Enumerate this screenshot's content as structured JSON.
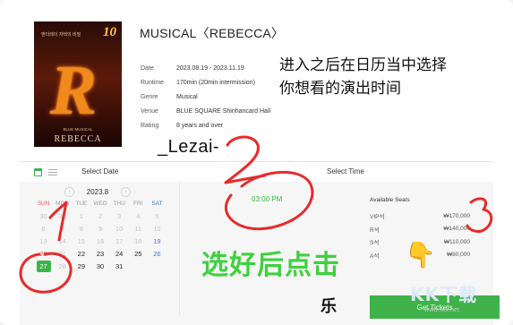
{
  "show": {
    "title": "MUSICAL〈REBECCA〉",
    "details": [
      {
        "key": "Date",
        "value": "2023.08.19 - 2023.11.19"
      },
      {
        "key": "Runtime",
        "value": "170min (20min intermission)"
      },
      {
        "key": "Genre",
        "value": "Musical"
      },
      {
        "key": "Venue",
        "value": "BLUE SQUARE Shinhancard Hall"
      },
      {
        "key": "Rating",
        "value": "8 years and over"
      }
    ]
  },
  "poster": {
    "badge": "10",
    "letter": "R",
    "tagline": "맨더레이 저택의 비밀",
    "subtitle": "BLUE MUSICAL",
    "name": "REBECCA"
  },
  "date_panel": {
    "header": "Select Date",
    "month": "2023.8",
    "prev": "‹",
    "next": "›",
    "weekdays": [
      "SUN",
      "MON",
      "TUE",
      "WED",
      "THU",
      "FRI",
      "SAT"
    ],
    "weeks": [
      [
        {
          "d": "30",
          "s": "muted"
        },
        {
          "d": "31",
          "s": "muted"
        },
        {
          "d": "1",
          "s": "muted"
        },
        {
          "d": "2",
          "s": "muted"
        },
        {
          "d": "3",
          "s": "muted"
        },
        {
          "d": "4",
          "s": "muted"
        },
        {
          "d": "5",
          "s": "muted"
        }
      ],
      [
        {
          "d": "6",
          "s": "muted"
        },
        {
          "d": "7",
          "s": "muted"
        },
        {
          "d": "8",
          "s": "muted"
        },
        {
          "d": "9",
          "s": "muted"
        },
        {
          "d": "10",
          "s": "muted"
        },
        {
          "d": "11",
          "s": "muted"
        },
        {
          "d": "12",
          "s": "muted"
        }
      ],
      [
        {
          "d": "13",
          "s": "muted"
        },
        {
          "d": "14",
          "s": "muted"
        },
        {
          "d": "15",
          "s": "muted"
        },
        {
          "d": "16",
          "s": "muted"
        },
        {
          "d": "17",
          "s": "muted"
        },
        {
          "d": "18",
          "s": "muted"
        },
        {
          "d": "19",
          "s": "sat"
        }
      ],
      [
        {
          "d": "20",
          "s": ""
        },
        {
          "d": "21",
          "s": "muted"
        },
        {
          "d": "22",
          "s": ""
        },
        {
          "d": "23",
          "s": ""
        },
        {
          "d": "24",
          "s": ""
        },
        {
          "d": "25",
          "s": ""
        },
        {
          "d": "26",
          "s": "sat"
        }
      ],
      [
        {
          "d": "27",
          "s": "sel"
        },
        {
          "d": "28",
          "s": "muted"
        },
        {
          "d": "29",
          "s": ""
        },
        {
          "d": "30",
          "s": ""
        },
        {
          "d": "31",
          "s": ""
        },
        {
          "d": "",
          "s": ""
        },
        {
          "d": "",
          "s": ""
        }
      ]
    ]
  },
  "time_panel": {
    "header": "Select Time",
    "times": [
      "03:00 PM"
    ],
    "seats_header": "Available Seats",
    "seats": [
      {
        "grade": "VIP석",
        "price": "₩170,000"
      },
      {
        "grade": "R석",
        "price": "₩140,000"
      },
      {
        "grade": "S석",
        "price": "₩110,000"
      },
      {
        "grade": "A석",
        "price": "₩80,000"
      }
    ],
    "cta": "Get Tickets"
  },
  "annotations": {
    "instruction_line1": "进入之后在日历当中选择",
    "instruction_line2": "你想看的演出时间",
    "username": "_Lezai-",
    "select_then_click": "选好后点击",
    "extra_char": "乐",
    "hand_emoji": "👇",
    "step_numbers": [
      "1",
      "2",
      "3"
    ]
  },
  "watermark": {
    "logo": "KK下载",
    "url": "www.kkx.net"
  },
  "colors": {
    "accent_green": "#3fb24a",
    "annotation_red": "#e82a2a",
    "annotation_green": "#3fd13f",
    "sunday_red": "#e55a5a",
    "saturday_blue": "#3a7bd5"
  }
}
